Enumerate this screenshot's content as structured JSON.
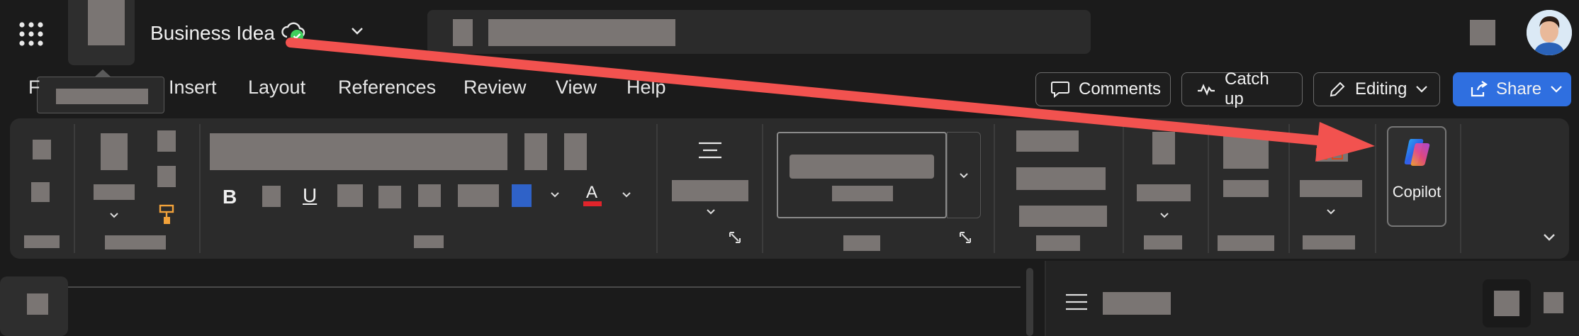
{
  "title_bar": {
    "doc_title": "Business Idea",
    "save_status_icon": "cloud-check-icon",
    "title_dropdown_icon": "chevron-down-icon",
    "apps_icon": "app-launcher-grid-icon"
  },
  "tabs": [
    {
      "label": "F"
    },
    {
      "label": "Insert"
    },
    {
      "label": "Layout"
    },
    {
      "label": "References"
    },
    {
      "label": "Review"
    },
    {
      "label": "View"
    },
    {
      "label": "Help"
    }
  ],
  "actions": {
    "comments_label": "Comments",
    "catchup_label": "Catch up",
    "editing_label": "Editing",
    "share_label": "Share"
  },
  "ribbon": {
    "bold_label": "B",
    "underline_label": "U",
    "font_color_label": "A",
    "copilot_label": "Copilot"
  },
  "colors": {
    "share_button": "#2f6fe0",
    "annotation_arrow": "#f2524f",
    "highlight_swatch": "#2f62c8",
    "font_color_bar": "#e0242b",
    "save_check": "#3fcf5c"
  }
}
